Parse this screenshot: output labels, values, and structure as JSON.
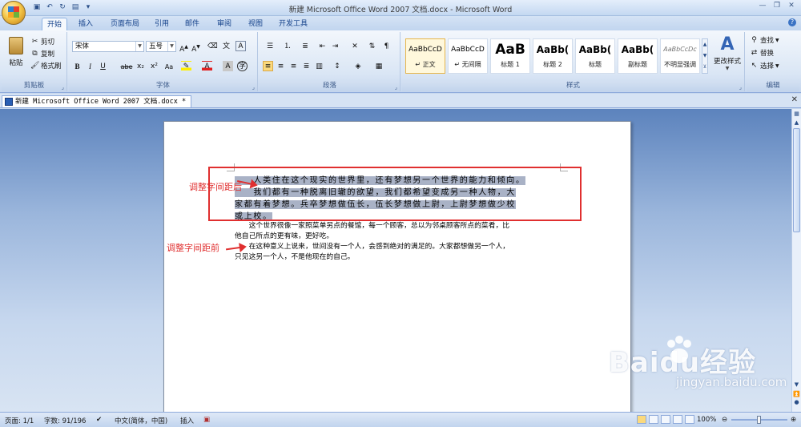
{
  "window": {
    "title": "新建 Microsoft Office Word 2007 文档.docx - Microsoft Word"
  },
  "quick_access": [
    "save-icon",
    "undo-icon",
    "redo-icon",
    "print-preview-icon",
    "customize-icon"
  ],
  "tabs": [
    "开始",
    "插入",
    "页面布局",
    "引用",
    "邮件",
    "审阅",
    "视图",
    "开发工具"
  ],
  "active_tab": "开始",
  "clipboard": {
    "paste": "粘贴",
    "cut": "剪切",
    "copy": "复制",
    "format_painter": "格式刷",
    "label": "剪贴板"
  },
  "font": {
    "name": "宋体",
    "size": "五号",
    "bold": "B",
    "italic": "I",
    "underline": "U",
    "strike": "abe",
    "sub": "x₂",
    "sup": "x²",
    "clear": "Aa",
    "label": "字体"
  },
  "paragraph": {
    "label": "段落"
  },
  "styles": {
    "label": "样式",
    "items": [
      {
        "preview": "AaBbCcD",
        "name": "↵ 正文"
      },
      {
        "preview": "AaBbCcD",
        "name": "↵ 无间隔"
      },
      {
        "preview": "AaB",
        "name": "标题 1"
      },
      {
        "preview": "AaBb(",
        "name": "标题 2"
      },
      {
        "preview": "AaBb(",
        "name": "标题"
      },
      {
        "preview": "AaBb(",
        "name": "副标题"
      },
      {
        "preview": "AaBbCcDc",
        "name": "不明显强调"
      }
    ],
    "change": "更改样式"
  },
  "editing": {
    "find": "查找",
    "replace": "替换",
    "select": "选择",
    "label": "编辑"
  },
  "document_tab": {
    "name": "新建 Microsoft Office Word 2007 文档.docx *"
  },
  "document": {
    "para1_lines": [
      "　　人类住在这个现实的世界里，还有梦想另一个世界的能力和倾向。",
      "　　我们都有一种脱离旧辙的欲望，我们都希望变成另一种人物，大",
      "家都有着梦想。兵卒梦想做伍长，伍长梦想做上尉，上尉梦想做少校",
      "或上校。"
    ],
    "para2_lines": [
      "　　这个世界很像一家照菜单另点的餐馆，每一个顾客，总以为邻桌顾客所点的菜肴，比",
      "他自己所点的更有味，更好吃。",
      "　　在这种意义上说来，世间没有一个人，会感到绝对的满足的。大家都想做另一个人，",
      "只见这另一个人，不是他现在的自己。"
    ]
  },
  "annotations": {
    "after": "调整字间距后",
    "before": "调整字间距前",
    "color": "#e02f2f"
  },
  "status": {
    "page": "页面: 1/1",
    "words": "字数: 91/196",
    "lang": "中文(简体，中国)",
    "mode": "插入",
    "zoom": "100%"
  },
  "watermark": {
    "logo": "Baidu经验",
    "url": "jingyan.baidu.com"
  }
}
